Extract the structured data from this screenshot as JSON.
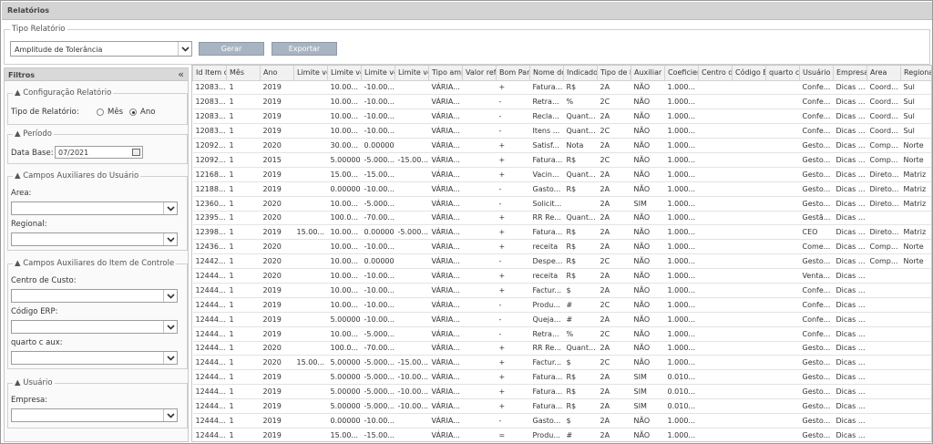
{
  "window_title": "Relatórios",
  "report_type": {
    "legend": "Tipo Relatório",
    "selected": "Amplitude de Tolerância",
    "generate_label": "Gerar",
    "export_label": "Exportar"
  },
  "filters": {
    "title": "Filtros",
    "collapse_icon": "«",
    "config": {
      "legend": "Configuração Relatório",
      "type_label": "Tipo de Relatório:",
      "opt_month": "Mês",
      "opt_year": "Ano"
    },
    "period": {
      "legend": "Período",
      "date_label": "Data Base:",
      "date_value": "07/2021"
    },
    "user_fields": {
      "legend": "Campos Auxiliares do Usuário",
      "area_label": "Area:",
      "regional_label": "Regional:"
    },
    "item_fields": {
      "legend": "Campos Auxiliares do Item de Controle",
      "cost_center_label": "Centro de Custo:",
      "erp_label": "Código ERP:",
      "quarter_label": "quarto c aux:"
    },
    "user": {
      "legend": "Usuário",
      "company_label": "Empresa:"
    }
  },
  "table": {
    "columns": [
      "Id Item d",
      "Mês",
      "Ano",
      "Limite ve",
      "Limite ve",
      "Limite ve",
      "Limite ve",
      "Tipo amp",
      "Valor refe",
      "Bom Para",
      "Nome do",
      "Indicador",
      "Tipo de I",
      "Auxiliar",
      "Coeficien",
      "Centro de",
      "Código E",
      "quarto c",
      "Usuário",
      "Empresa",
      "Area",
      "Regional"
    ],
    "rows": [
      [
        "12083...",
        "1",
        "2019",
        "",
        "10.00...",
        "-10.00...",
        "",
        "VÁRIA...",
        "",
        "+",
        "Fatura...",
        "R$",
        "2A",
        "NÃO",
        "1.000...",
        "",
        "",
        "",
        "Confe...",
        "Dicas ...",
        "Coord...",
        "Sul"
      ],
      [
        "12083...",
        "1",
        "2019",
        "",
        "10.00...",
        "-10.00...",
        "",
        "VÁRIA...",
        "",
        "-",
        "Retra...",
        "%",
        "2C",
        "NÃO",
        "1.000...",
        "",
        "",
        "",
        "Confe...",
        "Dicas ...",
        "Coord...",
        "Sul"
      ],
      [
        "12083...",
        "1",
        "2019",
        "",
        "10.00...",
        "-10.00...",
        "",
        "VÁRIA...",
        "",
        "-",
        "Recla...",
        "Quant...",
        "2A",
        "NÃO",
        "1.000...",
        "",
        "",
        "",
        "Confe...",
        "Dicas ...",
        "Coord...",
        "Sul"
      ],
      [
        "12083...",
        "1",
        "2019",
        "",
        "10.00...",
        "-10.00...",
        "",
        "VÁRIA...",
        "",
        "-",
        "Itens ...",
        "Quant...",
        "2C",
        "NÃO",
        "1.000...",
        "",
        "",
        "",
        "Confe...",
        "Dicas ...",
        "Coord...",
        "Sul"
      ],
      [
        "12092...",
        "1",
        "2020",
        "",
        "30.00...",
        "0.00000",
        "",
        "VÁRIA...",
        "",
        "+",
        "Satisf...",
        "Nota",
        "2A",
        "NÃO",
        "1.000...",
        "",
        "",
        "",
        "Gesto...",
        "Dicas ...",
        "Comp...",
        "Norte"
      ],
      [
        "12092...",
        "1",
        "2015",
        "",
        "5.00000",
        "-5.000...",
        "-15.00...",
        "VÁRIA...",
        "",
        "+",
        "Fatura...",
        "R$",
        "2C",
        "NÃO",
        "1.000...",
        "",
        "",
        "",
        "Gesto...",
        "Dicas ...",
        "Comp...",
        "Norte"
      ],
      [
        "12168...",
        "1",
        "2019",
        "",
        "15.00...",
        "-15.00...",
        "",
        "VÁRIA...",
        "",
        "+",
        "Vacin...",
        "Quant...",
        "2A",
        "NÃO",
        "1.000...",
        "",
        "",
        "",
        "Gesto...",
        "Dicas ...",
        "Direto...",
        "Matriz"
      ],
      [
        "12188...",
        "1",
        "2019",
        "",
        "0.00000",
        "-10.00...",
        "",
        "VÁRIA...",
        "",
        "-",
        "Gasto...",
        "R$",
        "2A",
        "NÃO",
        "1.000...",
        "",
        "",
        "",
        "Gesto...",
        "Dicas ...",
        "Direto...",
        "Matriz"
      ],
      [
        "12360...",
        "1",
        "2020",
        "",
        "10.00...",
        "-5.000...",
        "",
        "VÁRIA...",
        "",
        "-",
        "Solicit...",
        "",
        "2A",
        "SIM",
        "1.000...",
        "",
        "",
        "",
        "Gesto...",
        "Dicas ...",
        "Direto...",
        "Matriz"
      ],
      [
        "12395...",
        "1",
        "2020",
        "",
        "100.0...",
        "-70.00...",
        "",
        "VÁRIA...",
        "",
        "+",
        "RR Re...",
        "Quant...",
        "2A",
        "NÃO",
        "1.000...",
        "",
        "",
        "",
        "Gestã...",
        "Dicas ...",
        "",
        ""
      ],
      [
        "12398...",
        "1",
        "2019",
        "15.00...",
        "10.00...",
        "0.00000",
        "-5.000...",
        "VÁRIA...",
        "",
        "+",
        "Fatura...",
        "R$",
        "2A",
        "NÃO",
        "1.000...",
        "",
        "",
        "",
        "CEO",
        "Dicas ...",
        "Direto...",
        "Matriz"
      ],
      [
        "12436...",
        "1",
        "2020",
        "",
        "10.00...",
        "-10.00...",
        "",
        "VÁRIA...",
        "",
        "+",
        "receita",
        "R$",
        "2A",
        "NÃO",
        "1.000...",
        "",
        "",
        "",
        "Come...",
        "Dicas ...",
        "Comp...",
        "Norte"
      ],
      [
        "12442...",
        "1",
        "2020",
        "",
        "10.00...",
        "0.00000",
        "",
        "VÁRIA...",
        "",
        "-",
        "Despe...",
        "R$",
        "2C",
        "NÃO",
        "1.000...",
        "",
        "",
        "",
        "Gesto...",
        "Dicas ...",
        "Comp...",
        "Norte"
      ],
      [
        "12444...",
        "1",
        "2020",
        "",
        "10.00...",
        "-10.00...",
        "",
        "VÁRIA...",
        "",
        "+",
        "receita",
        "R$",
        "2A",
        "NÃO",
        "1.000...",
        "",
        "",
        "",
        "Venta...",
        "Dicas ...",
        "",
        ""
      ],
      [
        "12444...",
        "1",
        "2019",
        "",
        "10.00...",
        "-10.00...",
        "",
        "VÁRIA...",
        "",
        "+",
        "Factur...",
        "$",
        "2A",
        "NÃO",
        "1.000...",
        "",
        "",
        "",
        "Confe...",
        "Dicas ...",
        "",
        ""
      ],
      [
        "12444...",
        "1",
        "2019",
        "",
        "10.00...",
        "-10.00...",
        "",
        "VÁRIA...",
        "",
        "-",
        "Produ...",
        "#",
        "2C",
        "NÃO",
        "1.000...",
        "",
        "",
        "",
        "Confe...",
        "Dicas ...",
        "",
        ""
      ],
      [
        "12444...",
        "1",
        "2019",
        "",
        "5.00000",
        "-10.00...",
        "",
        "VÁRIA...",
        "",
        "-",
        "Queja...",
        "#",
        "2A",
        "NÃO",
        "1.000...",
        "",
        "",
        "",
        "Confe...",
        "Dicas ...",
        "",
        ""
      ],
      [
        "12444...",
        "1",
        "2019",
        "",
        "10.00...",
        "-5.000...",
        "",
        "VÁRIA...",
        "",
        "-",
        "Retra...",
        "%",
        "2C",
        "NÃO",
        "1.000...",
        "",
        "",
        "",
        "Confe...",
        "Dicas ...",
        "",
        ""
      ],
      [
        "12444...",
        "1",
        "2020",
        "",
        "100.0...",
        "-70.00...",
        "",
        "VÁRIA...",
        "",
        "+",
        "RR Re...",
        "Quant...",
        "2A",
        "NÃO",
        "1.000...",
        "",
        "",
        "",
        "Gesto...",
        "Dicas ...",
        "",
        ""
      ],
      [
        "12444...",
        "1",
        "2020",
        "15.00...",
        "5.00000",
        "-5.000...",
        "-15.00...",
        "VÁRIA...",
        "",
        "+",
        "Factur...",
        "$",
        "2C",
        "NÃO",
        "1.000...",
        "",
        "",
        "",
        "Gesto...",
        "Dicas ...",
        "",
        ""
      ],
      [
        "12444...",
        "1",
        "2019",
        "",
        "5.00000",
        "-5.000...",
        "-10.00...",
        "VÁRIA...",
        "",
        "+",
        "Fatura...",
        "R$",
        "2A",
        "SIM",
        "0.010...",
        "",
        "",
        "",
        "Gesto...",
        "Dicas ...",
        "",
        ""
      ],
      [
        "12444...",
        "1",
        "2019",
        "",
        "5.00000",
        "-5.000...",
        "-10.00...",
        "VÁRIA...",
        "",
        "+",
        "Fatura...",
        "R$",
        "2A",
        "SIM",
        "0.010...",
        "",
        "",
        "",
        "Gesto...",
        "Dicas ...",
        "",
        ""
      ],
      [
        "12444...",
        "1",
        "2019",
        "",
        "5.00000",
        "-5.000...",
        "-10.00...",
        "VÁRIA...",
        "",
        "+",
        "Fatura...",
        "R$",
        "2A",
        "SIM",
        "0.010...",
        "",
        "",
        "",
        "Gesto...",
        "Dicas ...",
        "",
        ""
      ],
      [
        "12444...",
        "1",
        "2019",
        "",
        "0.00000",
        "-10.00...",
        "",
        "VÁRIA...",
        "",
        "-",
        "Gasto...",
        "$",
        "2A",
        "NÃO",
        "1.000...",
        "",
        "",
        "",
        "Gesto...",
        "Dicas ...",
        "",
        ""
      ],
      [
        "12444...",
        "1",
        "2019",
        "",
        "15.00...",
        "-15.00...",
        "",
        "VÁRIA...",
        "",
        "=",
        "Produ...",
        "#",
        "2A",
        "NÃO",
        "1.000...",
        "",
        "",
        "",
        "Gesto...",
        "Dicas ...",
        "",
        ""
      ]
    ]
  }
}
